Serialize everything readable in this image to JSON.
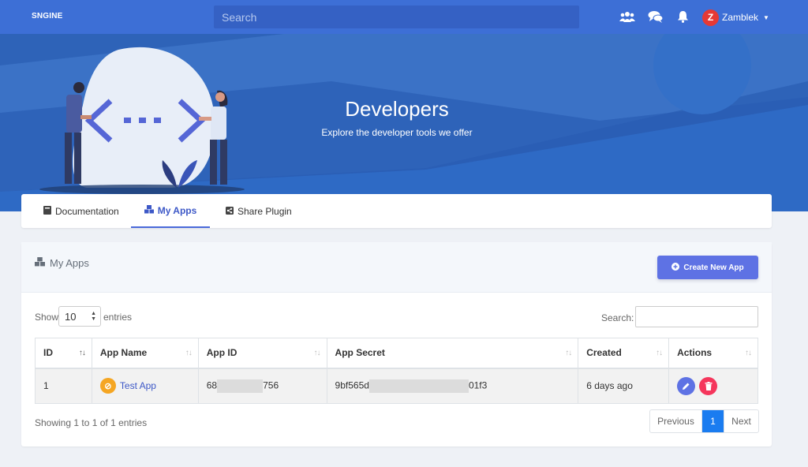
{
  "topnav": {
    "logo": "SNGINE",
    "search_placeholder": "Search",
    "icons": [
      "people-icon",
      "chat-icon",
      "bell-icon"
    ],
    "user": {
      "initial": "Z",
      "name": "Zamblek"
    }
  },
  "hero": {
    "title": "Developers",
    "subtitle": "Explore the developer tools we offer"
  },
  "tabs": [
    {
      "label": "Documentation",
      "icon": "book-icon",
      "active": false
    },
    {
      "label": "My Apps",
      "icon": "cubes-icon",
      "active": true
    },
    {
      "label": "Share Plugin",
      "icon": "share-icon",
      "active": false
    }
  ],
  "panel": {
    "title": "My Apps",
    "create_label": "Create New App",
    "show_label": "Show",
    "entries_value": "10",
    "entries_label": "entries",
    "search_label": "Search:"
  },
  "table": {
    "headers": [
      "ID",
      "App Name",
      "App ID",
      "App Secret",
      "Created",
      "Actions"
    ],
    "rows": [
      {
        "id": "1",
        "app_name": "Test App",
        "app_id_start": "68",
        "app_id_end": "756",
        "secret_start": "9bf565d",
        "secret_end": "01f3",
        "created": "6 days ago"
      }
    ]
  },
  "footer": {
    "info": "Showing 1 to 1 of 1 entries",
    "previous": "Previous",
    "page": "1",
    "next": "Next"
  },
  "colors": {
    "nav": "#3d6fd6",
    "hero": "#2e63b8",
    "accent": "#5e72e4",
    "danger": "#f5365c",
    "page_active": "#1a7cf0"
  }
}
